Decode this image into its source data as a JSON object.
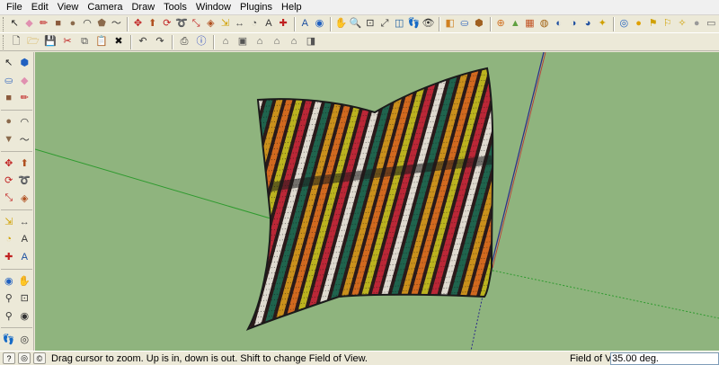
{
  "menu": [
    "File",
    "Edit",
    "View",
    "Camera",
    "Draw",
    "Tools",
    "Window",
    "Plugins",
    "Help"
  ],
  "toolbar_row1": {
    "tools": [
      {
        "icon": "select-arrow-icon",
        "glyph": "↖",
        "color": "#222"
      },
      {
        "icon": "eraser-icon",
        "glyph": "◆",
        "color": "#e090b0"
      },
      {
        "icon": "pencil-line-icon",
        "glyph": "✏",
        "color": "#c02020"
      },
      {
        "icon": "rectangle-icon",
        "glyph": "■",
        "color": "#8b5a3c"
      },
      {
        "icon": "circle-icon",
        "glyph": "●",
        "color": "#8b6a4c"
      },
      {
        "icon": "arc-icon",
        "glyph": "◠",
        "color": "#333"
      },
      {
        "icon": "polygon-icon",
        "glyph": "⬟",
        "color": "#8b6a4c"
      },
      {
        "icon": "freehand-icon",
        "glyph": "〜",
        "color": "#333"
      },
      {
        "icon": "move-icon",
        "glyph": "✥",
        "color": "#c02020"
      },
      {
        "icon": "push-pull-icon",
        "glyph": "⬆",
        "color": "#b05020"
      },
      {
        "icon": "rotate-icon",
        "glyph": "⟳",
        "color": "#c02020"
      },
      {
        "icon": "follow-me-icon",
        "glyph": "➰",
        "color": "#c02020"
      },
      {
        "icon": "scale-icon",
        "glyph": "⤡",
        "color": "#c02020"
      },
      {
        "icon": "offset-icon",
        "glyph": "◈",
        "color": "#b05020"
      },
      {
        "icon": "tape-measure-icon",
        "glyph": "⇲",
        "color": "#d0a000"
      },
      {
        "icon": "dimension-icon",
        "glyph": "↔",
        "color": "#555"
      },
      {
        "icon": "protractor-icon",
        "glyph": "◔",
        "color": "#555"
      },
      {
        "icon": "text-icon",
        "glyph": "A",
        "color": "#333"
      },
      {
        "icon": "axes-icon",
        "glyph": "✚",
        "color": "#c02020"
      },
      {
        "icon": "3d-text-icon",
        "glyph": "A",
        "color": "#1a4ea0"
      },
      {
        "icon": "orbit-icon",
        "glyph": "◉",
        "color": "#2060c0"
      },
      {
        "icon": "pan-icon",
        "glyph": "✋",
        "color": "#c08040"
      },
      {
        "icon": "zoom-icon",
        "glyph": "🔍",
        "color": "#333"
      },
      {
        "icon": "zoom-window-icon",
        "glyph": "⊡",
        "color": "#333"
      },
      {
        "icon": "zoom-extents-icon",
        "glyph": "⤢",
        "color": "#333"
      },
      {
        "icon": "position-camera-icon",
        "glyph": "◫",
        "color": "#2060a0"
      },
      {
        "icon": "walk-icon",
        "glyph": "👣",
        "color": "#333"
      },
      {
        "icon": "look-around-icon",
        "glyph": "👁",
        "color": "#333"
      },
      {
        "icon": "section-plane-icon",
        "glyph": "◧",
        "color": "#d08020"
      },
      {
        "icon": "paint-bucket-icon",
        "glyph": "⛀",
        "color": "#4070c0"
      },
      {
        "icon": "components-icon",
        "glyph": "⬢",
        "color": "#a06020"
      },
      {
        "icon": "add-location-icon",
        "glyph": "⊕",
        "color": "#d07020"
      },
      {
        "icon": "toggle-terrain-icon",
        "glyph": "▲",
        "color": "#60a040"
      },
      {
        "icon": "photo-textures-icon",
        "glyph": "▦",
        "color": "#c05020"
      },
      {
        "icon": "get-models-icon",
        "glyph": "◍",
        "color": "#a06010"
      },
      {
        "icon": "share-model-icon",
        "glyph": "◐",
        "color": "#2050a0"
      },
      {
        "icon": "share-component-icon",
        "glyph": "◑",
        "color": "#2050a0"
      },
      {
        "icon": "send-to-layout-icon",
        "glyph": "◕",
        "color": "#2050a0"
      },
      {
        "icon": "extension-warehouse-icon",
        "glyph": "✦",
        "color": "#d0a000"
      },
      {
        "icon": "styles-icon",
        "glyph": "◎",
        "color": "#2060c0"
      },
      {
        "icon": "shadows-icon",
        "glyph": "●",
        "color": "#e0a000"
      },
      {
        "icon": "flag-icon",
        "glyph": "⚑",
        "color": "#d0a000"
      },
      {
        "icon": "fog-icon",
        "glyph": "⚐",
        "color": "#d0a000"
      },
      {
        "icon": "sun-icon",
        "glyph": "✧",
        "color": "#d0a000"
      },
      {
        "icon": "sphere-icon",
        "glyph": "●",
        "color": "#999"
      },
      {
        "icon": "window-icon",
        "glyph": "▭",
        "color": "#666"
      }
    ]
  },
  "toolbar_row2": {
    "tools": [
      {
        "icon": "new-file-icon",
        "glyph": "🗋",
        "color": "#333"
      },
      {
        "icon": "open-folder-icon",
        "glyph": "🗁",
        "color": "#d0a030"
      },
      {
        "icon": "save-icon",
        "glyph": "💾",
        "color": "#2040a0"
      },
      {
        "icon": "cut-icon",
        "glyph": "✂",
        "color": "#c02020"
      },
      {
        "icon": "copy-icon",
        "glyph": "⧉",
        "color": "#555"
      },
      {
        "icon": "paste-icon",
        "glyph": "📋",
        "color": "#c08040"
      },
      {
        "icon": "delete-icon",
        "glyph": "✖",
        "color": "#111"
      },
      {
        "icon": "undo-icon",
        "glyph": "↶",
        "color": "#333"
      },
      {
        "icon": "redo-icon",
        "glyph": "↷",
        "color": "#333"
      },
      {
        "icon": "print-icon",
        "glyph": "⎙",
        "color": "#333"
      },
      {
        "icon": "model-info-icon",
        "glyph": "ⓘ",
        "color": "#2040c0"
      },
      {
        "icon": "iso-view-icon",
        "glyph": "⌂",
        "color": "#555"
      },
      {
        "icon": "top-view-icon",
        "glyph": "▣",
        "color": "#555"
      },
      {
        "icon": "front-view-icon",
        "glyph": "⌂",
        "color": "#555"
      },
      {
        "icon": "right-view-icon",
        "glyph": "⌂",
        "color": "#555"
      },
      {
        "icon": "back-view-icon",
        "glyph": "⌂",
        "color": "#555"
      },
      {
        "icon": "left-view-icon",
        "glyph": "◨",
        "color": "#555"
      }
    ]
  },
  "palette": [
    [
      {
        "icon": "select-tool-icon",
        "glyph": "↖",
        "color": "#222"
      },
      {
        "icon": "make-component-icon",
        "glyph": "⬢",
        "color": "#2060c0"
      }
    ],
    [
      {
        "icon": "paint-tool-icon",
        "glyph": "⛀",
        "color": "#4070c0"
      },
      {
        "icon": "eraser-tool-icon",
        "glyph": "◆",
        "color": "#e090b0"
      }
    ],
    [
      {
        "icon": "rectangle-tool-icon",
        "glyph": "■",
        "color": "#8b5a3c"
      },
      {
        "icon": "line-tool-icon",
        "glyph": "✏",
        "color": "#c02020"
      }
    ],
    [
      {
        "icon": "circle-tool-icon",
        "glyph": "●",
        "color": "#8b6a4c"
      },
      {
        "icon": "arc-tool-icon",
        "glyph": "◠",
        "color": "#333"
      }
    ],
    [
      {
        "icon": "polygon-tool-icon",
        "glyph": "▼",
        "color": "#8b6a4c"
      },
      {
        "icon": "freehand-tool-icon",
        "glyph": "〜",
        "color": "#333"
      }
    ],
    [
      {
        "icon": "move-tool-icon",
        "glyph": "✥",
        "color": "#c02020"
      },
      {
        "icon": "push-pull-tool-icon",
        "glyph": "⬆",
        "color": "#b05020"
      }
    ],
    [
      {
        "icon": "rotate-tool-icon",
        "glyph": "⟳",
        "color": "#c02020"
      },
      {
        "icon": "follow-me-tool-icon",
        "glyph": "➰",
        "color": "#c02020"
      }
    ],
    [
      {
        "icon": "scale-tool-icon",
        "glyph": "⤡",
        "color": "#c02020"
      },
      {
        "icon": "offset-tool-icon",
        "glyph": "◈",
        "color": "#b05020"
      }
    ],
    [
      {
        "icon": "tape-tool-icon",
        "glyph": "⇲",
        "color": "#d0a000"
      },
      {
        "icon": "dimension-tool-icon",
        "glyph": "↔",
        "color": "#555"
      }
    ],
    [
      {
        "icon": "protractor-tool-icon",
        "glyph": "◔",
        "color": "#d0a000"
      },
      {
        "icon": "text-tool-icon",
        "glyph": "A",
        "color": "#333"
      }
    ],
    [
      {
        "icon": "axes-tool-icon",
        "glyph": "✚",
        "color": "#c02020"
      },
      {
        "icon": "3d-text-tool-icon",
        "glyph": "A",
        "color": "#1a4ea0"
      }
    ],
    [
      {
        "icon": "orbit-tool-icon",
        "glyph": "◉",
        "color": "#2060c0"
      },
      {
        "icon": "pan-tool-icon",
        "glyph": "✋",
        "color": "#c08040"
      }
    ],
    [
      {
        "icon": "zoom-tool-icon",
        "glyph": "⚲",
        "color": "#333"
      },
      {
        "icon": "zoom-window-tool-icon",
        "glyph": "⊡",
        "color": "#333"
      }
    ],
    [
      {
        "icon": "position-camera-tool-icon",
        "glyph": "⚲",
        "color": "#333"
      },
      {
        "icon": "look-around-tool-icon",
        "glyph": "◉",
        "color": "#333"
      }
    ],
    [
      {
        "icon": "walk-tool-icon",
        "glyph": "👣",
        "color": "#333"
      },
      {
        "icon": "section-plane-tool-icon",
        "glyph": "◎",
        "color": "#333"
      }
    ]
  ],
  "status": {
    "hint_icons": [
      {
        "icon": "help-question-icon",
        "glyph": "?"
      },
      {
        "icon": "geo-location-icon",
        "glyph": "◎"
      },
      {
        "icon": "credits-icon",
        "glyph": "©"
      }
    ],
    "message": "Drag cursor to zoom.  Up is in, down is out. Shift to change Field of View.",
    "vcb_label": "Field of View",
    "vcb_value": "35.00 deg."
  },
  "colors": {
    "sky_ground": "#8fb47e",
    "stripe_colors": [
      "#c8283a",
      "#efeae0",
      "#1e6a52",
      "#d89a1c",
      "#e07020",
      "#c8c020"
    ]
  }
}
